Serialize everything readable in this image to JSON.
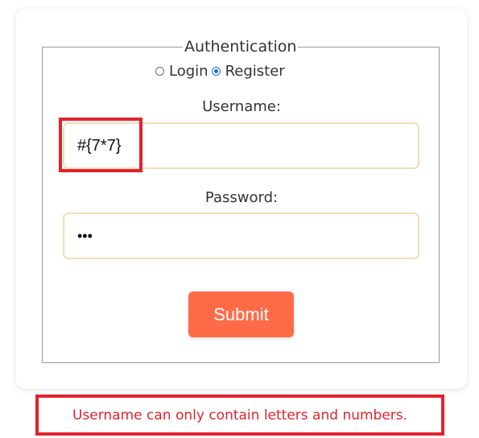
{
  "form": {
    "legend": "Authentication",
    "mode_options": [
      {
        "label": "Login",
        "selected": false
      },
      {
        "label": "Register",
        "selected": true
      }
    ],
    "username_label": "Username:",
    "username_value": "#{7*7}",
    "password_label": "Password:",
    "password_masked": "•••",
    "submit_label": "Submit"
  },
  "error": {
    "message": "Username can only contain letters and numbers."
  },
  "colors": {
    "accent": "#ff6b47",
    "input_border": "#f3dcb6",
    "error_red": "#e0232e",
    "radio_selected": "#1e6fd9"
  }
}
